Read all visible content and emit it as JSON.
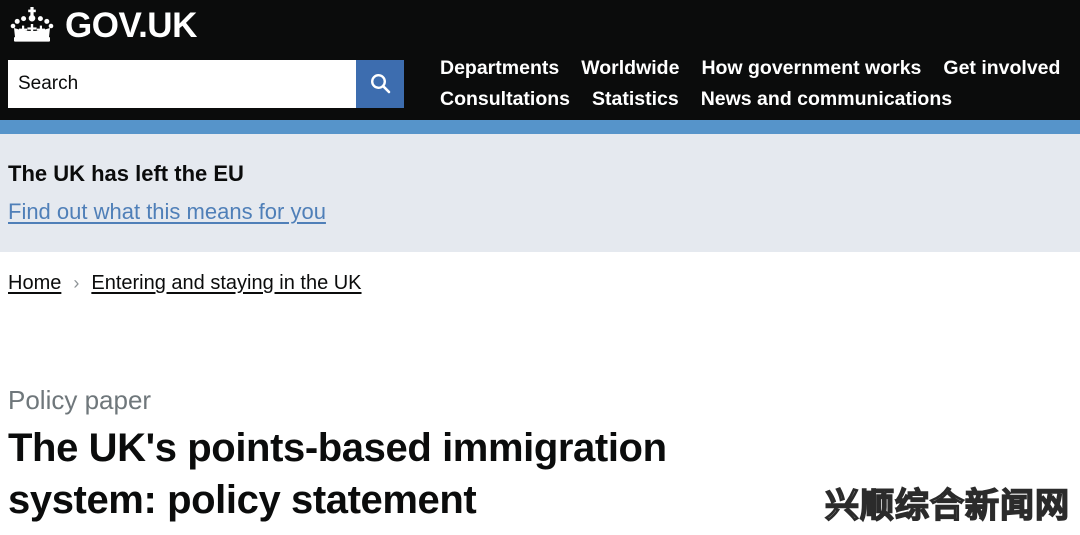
{
  "header": {
    "brand_name": "GOV.UK",
    "logo_icon": "crown-icon",
    "search": {
      "placeholder": "Search",
      "value": "",
      "button_icon": "search-icon",
      "button_color": "#3d6daf"
    },
    "nav_rows": [
      [
        {
          "label": "Departments"
        },
        {
          "label": "Worldwide"
        },
        {
          "label": "How government works"
        },
        {
          "label": "Get involved"
        }
      ],
      [
        {
          "label": "Consultations"
        },
        {
          "label": "Statistics"
        },
        {
          "label": "News and communications"
        }
      ]
    ],
    "background": "#0b0c0c"
  },
  "stripe": {
    "color": "#5694ca"
  },
  "eu_banner": {
    "title": "The UK has left the EU",
    "link_label": "Find out what this means for you",
    "background": "#e5e9ef",
    "link_color": "#4f7fb8"
  },
  "breadcrumb": {
    "separator": "›",
    "items": [
      {
        "label": "Home"
      },
      {
        "label": "Entering and staying in the UK"
      }
    ]
  },
  "main": {
    "doc_type": "Policy paper",
    "title": "The UK's points-based immigration system: policy statement",
    "doc_type_color": "#6f777b"
  },
  "watermark": {
    "text": "兴顺综合新闻网"
  }
}
